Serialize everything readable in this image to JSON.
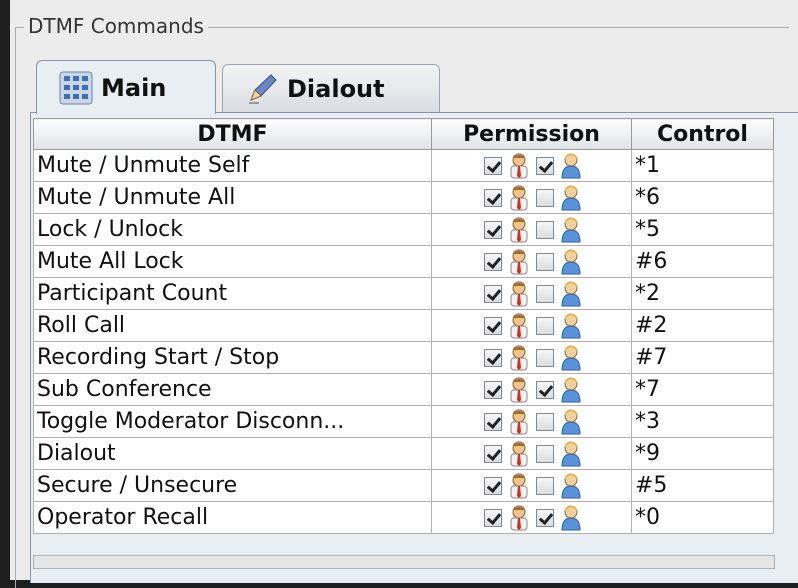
{
  "group": {
    "title": "DTMF Commands"
  },
  "tabs": [
    {
      "label": "Main",
      "icon": "keypad-grid-icon"
    },
    {
      "label": "Dialout",
      "icon": "pencil-icon"
    }
  ],
  "table": {
    "headers": [
      "DTMF",
      "Permission",
      "Control"
    ],
    "rows": [
      {
        "name": "Mute / Unmute Self",
        "moderator": true,
        "participant": true,
        "control": "*1"
      },
      {
        "name": "Mute / Unmute All",
        "moderator": true,
        "participant": false,
        "control": "*6"
      },
      {
        "name": "Lock / Unlock",
        "moderator": true,
        "participant": false,
        "control": "*5"
      },
      {
        "name": "Mute All Lock",
        "moderator": true,
        "participant": false,
        "control": "#6"
      },
      {
        "name": "Participant Count",
        "moderator": true,
        "participant": false,
        "control": "*2"
      },
      {
        "name": "Roll Call",
        "moderator": true,
        "participant": false,
        "control": "#2"
      },
      {
        "name": "Recording Start / Stop",
        "moderator": true,
        "participant": false,
        "control": "#7"
      },
      {
        "name": "Sub Conference",
        "moderator": true,
        "participant": true,
        "control": "*7"
      },
      {
        "name": "Toggle Moderator Disconn...",
        "moderator": true,
        "participant": false,
        "control": "*3"
      },
      {
        "name": "Dialout",
        "moderator": true,
        "participant": false,
        "control": "*9"
      },
      {
        "name": "Secure / Unsecure",
        "moderator": true,
        "participant": false,
        "control": "#5"
      },
      {
        "name": "Operator Recall",
        "moderator": true,
        "participant": true,
        "control": "*0"
      }
    ]
  },
  "icons": {
    "moderator": "moderator-icon",
    "participant": "participant-icon"
  }
}
